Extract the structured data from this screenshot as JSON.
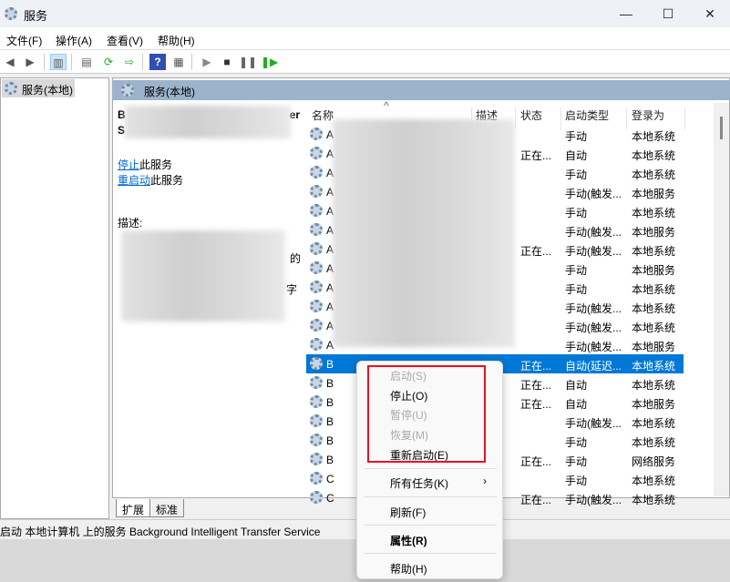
{
  "window": {
    "title": "服务",
    "controls": [
      "—",
      "☐",
      "✕"
    ]
  },
  "menubar": [
    "文件(F)",
    "操作(A)",
    "查看(V)",
    "帮助(H)"
  ],
  "toolbar": [
    "back-icon",
    "forward-icon",
    "show-tree-icon",
    "properties-icon",
    "refresh-icon",
    "export-icon",
    "help-icon",
    "console-icon",
    "start-icon",
    "stop-icon",
    "pause-icon",
    "resume-icon"
  ],
  "tree": {
    "root": "服务(本地)"
  },
  "panel": {
    "header": "服务(本地)",
    "name_partial": [
      "B",
      "S"
    ],
    "name_partial_end": "er",
    "stop_link": "停止",
    "stop_suffix": "此服务",
    "restart_link": "重启动",
    "restart_suffix": "此服务",
    "desc_label": "描述:",
    "desc_fragments": [
      "的",
      "字"
    ]
  },
  "columns": [
    "名称",
    "描述",
    "状态",
    "启动类型",
    "登录为"
  ],
  "rows": [
    {
      "n": "A",
      "s": "",
      "t": "手动",
      "l": "本地系统"
    },
    {
      "n": "A",
      "s": "正在...",
      "t": "自动",
      "l": "本地系统"
    },
    {
      "n": "A",
      "s": "",
      "t": "手动",
      "l": "本地系统"
    },
    {
      "n": "A",
      "s": "",
      "t": "手动(触发...",
      "l": "本地服务"
    },
    {
      "n": "A",
      "s": "",
      "t": "手动",
      "l": "本地系统"
    },
    {
      "n": "A",
      "s": "",
      "t": "手动(触发...",
      "l": "本地服务"
    },
    {
      "n": "A",
      "s": "正在...",
      "t": "手动(触发...",
      "l": "本地系统"
    },
    {
      "n": "A",
      "s": "",
      "t": "手动",
      "l": "本地服务"
    },
    {
      "n": "A",
      "s": "",
      "t": "手动",
      "l": "本地系统"
    },
    {
      "n": "A",
      "s": "",
      "t": "手动(触发...",
      "l": "本地系统"
    },
    {
      "n": "A",
      "s": "",
      "t": "手动(触发...",
      "l": "本地系统"
    },
    {
      "n": "A",
      "s": "",
      "t": "手动(触发...",
      "l": "本地服务"
    },
    {
      "n": "B",
      "s": "正在...",
      "t": "自动(延迟...",
      "l": "本地系统",
      "selected": true
    },
    {
      "n": "B",
      "s": "正在...",
      "t": "自动",
      "l": "本地系统"
    },
    {
      "n": "B",
      "s": "正在...",
      "t": "自动",
      "l": "本地服务"
    },
    {
      "n": "B",
      "s": "",
      "t": "手动(触发...",
      "l": "本地系统"
    },
    {
      "n": "B",
      "s": "",
      "t": "手动",
      "l": "本地系统"
    },
    {
      "n": "B",
      "s": "正在...",
      "t": "手动",
      "l": "网络服务"
    },
    {
      "n": "C",
      "s": "",
      "t": "手动",
      "l": "本地系统"
    },
    {
      "n": "C",
      "s": "正在...",
      "t": "手动(触发...",
      "l": "本地系统"
    }
  ],
  "tabs": [
    "扩展",
    "标准"
  ],
  "status": "启动 本地计算机 上的服务 Background Intelligent Transfer Service",
  "context_menu": [
    {
      "label": "启动(S)",
      "disabled": true
    },
    {
      "label": "停止(O)",
      "disabled": false
    },
    {
      "label": "暂停(U)",
      "disabled": true
    },
    {
      "label": "恢复(M)",
      "disabled": true
    },
    {
      "label": "重新启动(E)",
      "disabled": false
    },
    {
      "label": "所有任务(K)",
      "submenu": true
    },
    {
      "label": "刷新(F)"
    },
    {
      "label": "属性(R)",
      "bold": true
    },
    {
      "label": "帮助(H)"
    }
  ],
  "colors": {
    "selection": "#0078d7",
    "highlight_box": "#e81123",
    "panel_header": "#9db3cc"
  }
}
